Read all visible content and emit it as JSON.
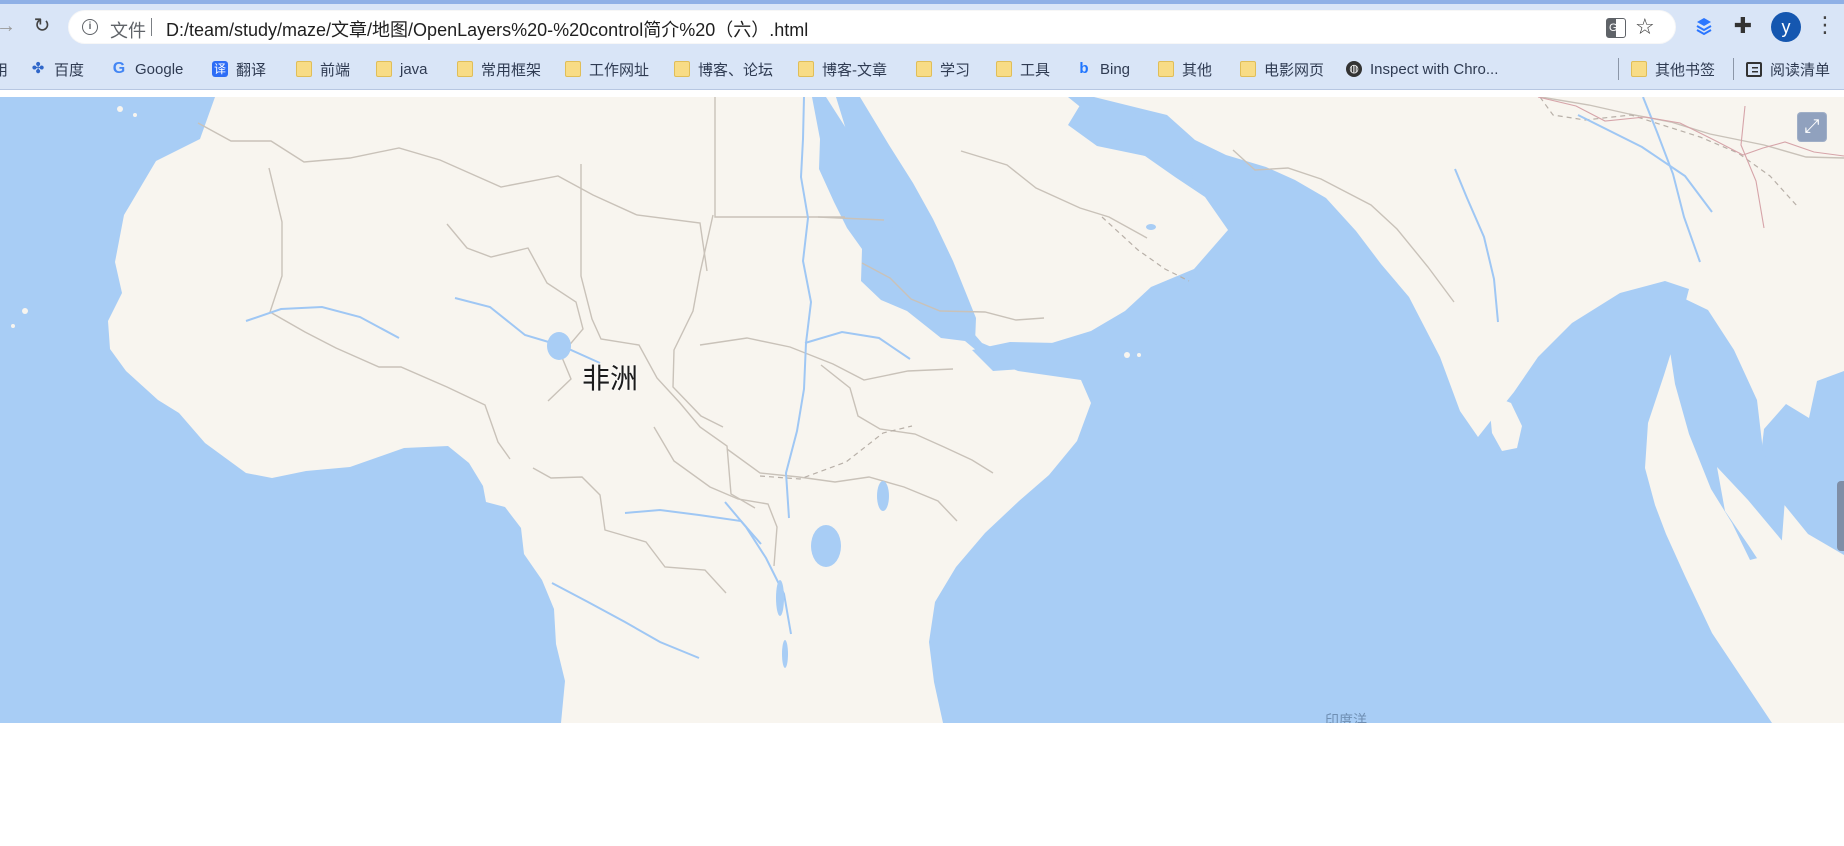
{
  "browser": {
    "address": {
      "site_label": "文件",
      "url": "D:/team/study/maze/文章/地图/OpenLayers%20-%20control简介%20（六）.html"
    },
    "profile_initial": "y",
    "bookmarks": [
      {
        "label": "用",
        "icon": "folder-icon"
      },
      {
        "label": "百度",
        "icon": "baidu-icon"
      },
      {
        "label": "Google",
        "icon": "google-icon"
      },
      {
        "label": "翻译",
        "icon": "translate-icon"
      },
      {
        "label": "前端",
        "icon": "folder-icon"
      },
      {
        "label": "java",
        "icon": "folder-icon"
      },
      {
        "label": "常用框架",
        "icon": "folder-icon"
      },
      {
        "label": "工作网址",
        "icon": "folder-icon"
      },
      {
        "label": "博客、论坛",
        "icon": "folder-icon"
      },
      {
        "label": "博客-文章",
        "icon": "folder-icon"
      },
      {
        "label": "学习",
        "icon": "folder-icon"
      },
      {
        "label": "工具",
        "icon": "folder-icon"
      },
      {
        "label": "Bing",
        "icon": "bing-icon"
      },
      {
        "label": "其他",
        "icon": "folder-icon"
      },
      {
        "label": "电影网页",
        "icon": "folder-icon"
      },
      {
        "label": "Inspect with Chro...",
        "icon": "globe-icon"
      },
      {
        "label": "其他书签",
        "icon": "folder-icon"
      },
      {
        "label": "阅读清单",
        "icon": "reading-list-icon"
      }
    ]
  },
  "map": {
    "continent_label": "非洲",
    "ocean_label": "印度洋",
    "colors": {
      "ocean": "#a8cdf5",
      "land": "#f8f5ef",
      "border": "#c9c2b9",
      "river": "#9fc7f4",
      "control": "#506ea0"
    }
  }
}
